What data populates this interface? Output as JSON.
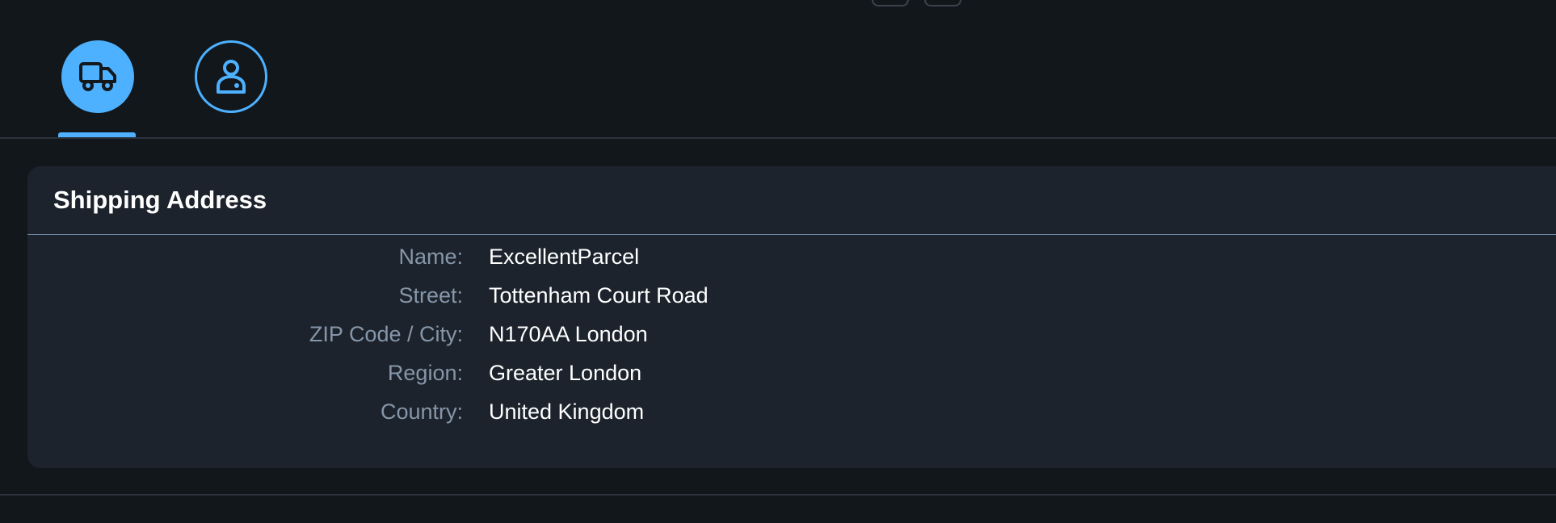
{
  "tabs": [
    {
      "icon": "shipping-truck-icon",
      "active": true
    },
    {
      "icon": "customer-person-icon",
      "active": false
    }
  ],
  "colors": {
    "background": "#12171c",
    "panel": "#1c232c",
    "accent": "#4db1ff",
    "label": "#8696a9",
    "value": "#ffffff"
  },
  "section": {
    "title": "Shipping Address"
  },
  "fields": {
    "name": {
      "label": "Name:",
      "value": "ExcellentParcel"
    },
    "street": {
      "label": "Street:",
      "value": "Tottenham Court Road"
    },
    "zip_city": {
      "label": "ZIP Code / City:",
      "value": "N170AA London"
    },
    "region": {
      "label": "Region:",
      "value": "Greater London"
    },
    "country": {
      "label": "Country:",
      "value": "United Kingdom"
    }
  }
}
